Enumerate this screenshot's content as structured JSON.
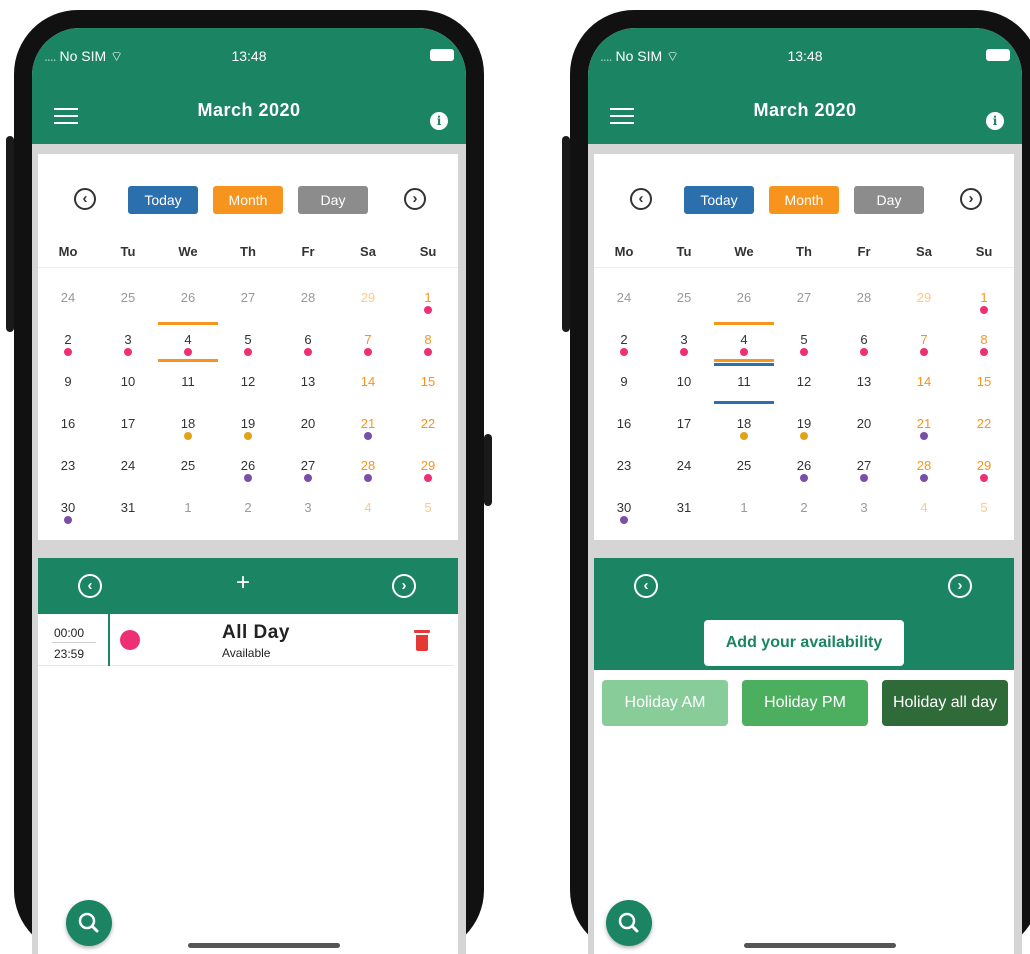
{
  "phones": [
    {
      "status": {
        "carrier": "No SIM",
        "time": "13:48"
      },
      "header": {
        "title": "March 2020"
      },
      "calendar": {
        "buttons": {
          "today": "Today",
          "month": "Month",
          "day": "Day"
        },
        "weekdays": [
          "Mo",
          "Tu",
          "We",
          "Th",
          "Fr",
          "Sa",
          "Su"
        ],
        "weeks": [
          [
            "24",
            "25",
            "26",
            "27",
            "28",
            "29",
            "1"
          ],
          [
            "2",
            "3",
            "4",
            "5",
            "6",
            "7",
            "8"
          ],
          [
            "9",
            "10",
            "11",
            "12",
            "13",
            "14",
            "15"
          ],
          [
            "16",
            "17",
            "18",
            "19",
            "20",
            "21",
            "22"
          ],
          [
            "23",
            "24",
            "25",
            "26",
            "27",
            "28",
            "29"
          ],
          [
            "30",
            "31",
            "1",
            "2",
            "3",
            "4",
            "5"
          ]
        ]
      },
      "event": {
        "start": "00:00",
        "end": "23:59",
        "title": "All Day",
        "subtitle": "Available"
      }
    },
    {
      "status": {
        "carrier": "No SIM",
        "time": "13:48"
      },
      "header": {
        "title": "March 2020"
      },
      "calendar": {
        "buttons": {
          "today": "Today",
          "month": "Month",
          "day": "Day"
        },
        "weekdays": [
          "Mo",
          "Tu",
          "We",
          "Th",
          "Fr",
          "Sa",
          "Su"
        ],
        "weeks": [
          [
            "24",
            "25",
            "26",
            "27",
            "28",
            "29",
            "1"
          ],
          [
            "2",
            "3",
            "4",
            "5",
            "6",
            "7",
            "8"
          ],
          [
            "9",
            "10",
            "11",
            "12",
            "13",
            "14",
            "15"
          ],
          [
            "16",
            "17",
            "18",
            "19",
            "20",
            "21",
            "22"
          ],
          [
            "23",
            "24",
            "25",
            "26",
            "27",
            "28",
            "29"
          ],
          [
            "30",
            "31",
            "1",
            "2",
            "3",
            "4",
            "5"
          ]
        ]
      },
      "availability": {
        "add_label": "Add your availability",
        "holiday_am": "Holiday AM",
        "holiday_pm": "Holiday PM",
        "holiday_all": "Holiday all day"
      }
    }
  ],
  "colors": {
    "brand_green": "#1b8563",
    "today_blue": "#2c6fad",
    "month_orange": "#f7941d",
    "day_gray": "#8c8c8c",
    "dot_pink": "#ef2f74",
    "dot_yellow": "#e3a21a",
    "dot_purple": "#7b4fa8",
    "weekend_orange": "#f7941d",
    "delete_red": "#e53935",
    "holiday_am": "#88cc9a",
    "holiday_pm": "#4caf5f",
    "holiday_all": "#2e6b38"
  },
  "icons": [
    "menu-icon",
    "info-icon",
    "chevron-left-icon",
    "chevron-right-icon",
    "plus-icon",
    "trash-icon",
    "search-icon"
  ]
}
